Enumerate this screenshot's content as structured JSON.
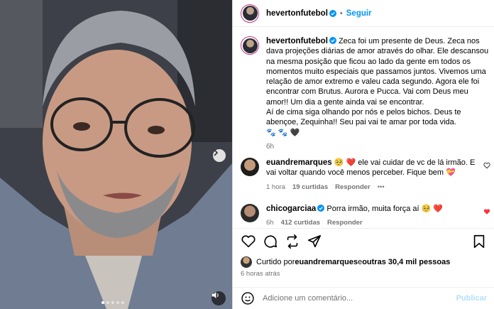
{
  "post": {
    "username": "hevertonfutebol",
    "follow_label": "Seguir",
    "separator": "•",
    "caption_text": "Zeca foi um presente de Deus. Zeca nos dava projeções diárias de amor através do olhar. Ele descansou na mesma posição que ficou ao lado da gente em todos os momentos muito especiais que passamos juntos. Vivemos uma relação de amor extremo e valeu cada segundo. Agora ele foi encontrar com Brutus. Aurora e Pucca. Vai com Deus meu amor!! Um dia a gente ainda vai se encontrar.",
    "caption_text2": "Aí de cima siga olhando por nós e pelos bichos. Deus te abençoe, Zequinha!! Seu pai vai te amar por toda vida.",
    "caption_emojis": "🐾 🐾 🖤",
    "caption_age": "6h"
  },
  "comments": [
    {
      "username": "euandremarques",
      "text": "🥺 ❤️ ele vai cuidar de vc de lá irmão. E vai voltar quando você menos perceber. Fique bem 💝",
      "age": "1 hora",
      "likes": "19 curtidas",
      "reply": "Responder",
      "more": "•••"
    },
    {
      "username": "chicogarciaa",
      "text": "Porra irmão, muita força aí 🥺 ❤️",
      "age": "6h",
      "likes": "412 curtidas",
      "reply": "Responder"
    }
  ],
  "likes_line": {
    "prefix": "Curtido por ",
    "user": "euandremarques",
    "middle": " e ",
    "others": "outras 30,4 mil pessoas"
  },
  "posted_ago": "6 horas atrás",
  "add_comment": {
    "placeholder": "Adicione um comentário...",
    "publish_label": "Publicar"
  },
  "icons": {
    "heart": "heart-icon",
    "comment": "comment-icon",
    "share": "repost-icon",
    "send": "send-icon",
    "save": "bookmark-icon",
    "emoji": "emoji-icon",
    "verified": "verified-badge-icon",
    "sound": "speaker-icon",
    "next": "chevron-right-icon"
  },
  "colors": {
    "link_blue": "#0095f6",
    "verified_blue": "#0095f6",
    "liked_red": "#ff3040",
    "muted": "#737373"
  },
  "carousel": {
    "count": 5,
    "active": 1
  }
}
